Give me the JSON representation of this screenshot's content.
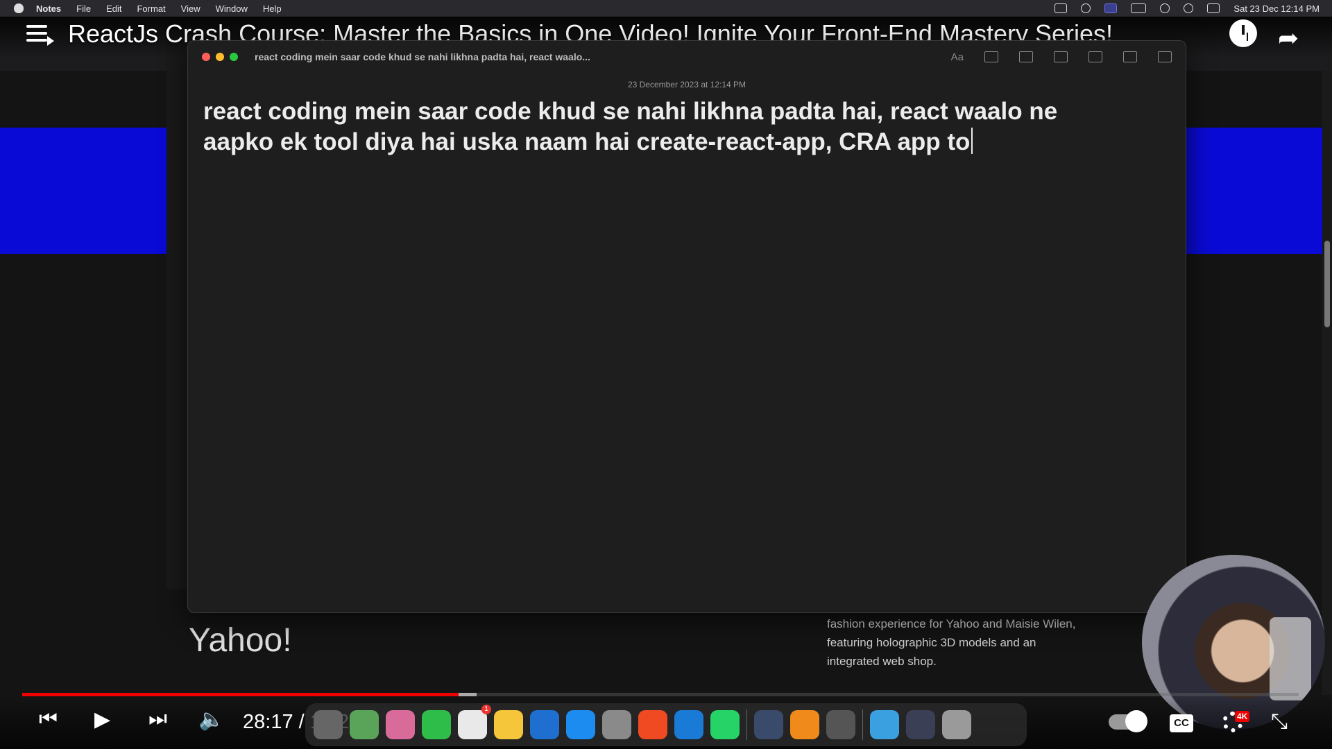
{
  "menubar": {
    "app": "Notes",
    "items": [
      "File",
      "Edit",
      "Format",
      "View",
      "Window",
      "Help"
    ],
    "datetime": "Sat 23 Dec  12:14 PM"
  },
  "youtube": {
    "title": "ReactJs Crash Course: Master the Basics in One Video! Ignite Your Front-End Mastery Series!",
    "time": "28:17 / 1:22:49",
    "progress": 0.342,
    "buffered": 0.356,
    "quality_badge": "4K",
    "cc_label": "CC"
  },
  "notes": {
    "window_title": "react coding mein saar code khud se nahi likhna padta hai, react waalo...",
    "date": "23 December 2023 at 12:14 PM",
    "body_line1": "react coding mein saar code khud se nahi likhna padta hai, react waalo ne",
    "body_line2": "aapko ek tool diya hai uska naam hai create-react-app, CRA app to",
    "tools": [
      "Aa",
      "checklist-icon",
      "table-icon",
      "link-icon",
      "media-icon",
      "lock-icon",
      "share-icon"
    ]
  },
  "browser_page": {
    "brand": "Yahoo!",
    "description": "fashion experience for Yahoo and Maisie Wilen, featuring holographic 3D models and an integrated web shop."
  },
  "dock": {
    "reminders_badge": "1",
    "icons": [
      "launchpad",
      "maps",
      "photos",
      "facetime",
      "reminders",
      "notes",
      "keynote",
      "app-store",
      "system-settings",
      "brave",
      "vscode",
      "whatsapp",
      "screen-recorder",
      "vlc",
      "calculator",
      "downloads",
      "screenshot",
      "trash"
    ],
    "colors": {
      "accent_red": "#ff0000",
      "notes_yellow": "#f5c63a",
      "blue_band": "#0a0ad6"
    }
  }
}
